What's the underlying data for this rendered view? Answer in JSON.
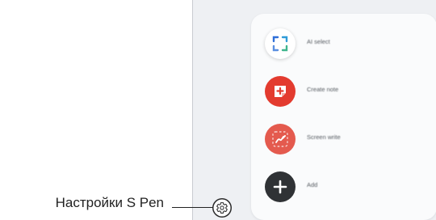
{
  "menu": {
    "items": [
      {
        "label": "AI select",
        "icon": "ai-select-icon"
      },
      {
        "label": "Create note",
        "icon": "create-note-icon"
      },
      {
        "label": "Screen write",
        "icon": "screen-write-icon"
      },
      {
        "label": "Add",
        "icon": "add-icon"
      }
    ]
  },
  "settings": {
    "icon": "gear-icon"
  },
  "callout": {
    "label": "Настройки S Pen"
  },
  "colors": {
    "create_note": "#e33b2f",
    "screen_write": "#e45a4e",
    "add": "#2f3235",
    "panel": "#fafbfc",
    "screen": "#eef0f3"
  }
}
